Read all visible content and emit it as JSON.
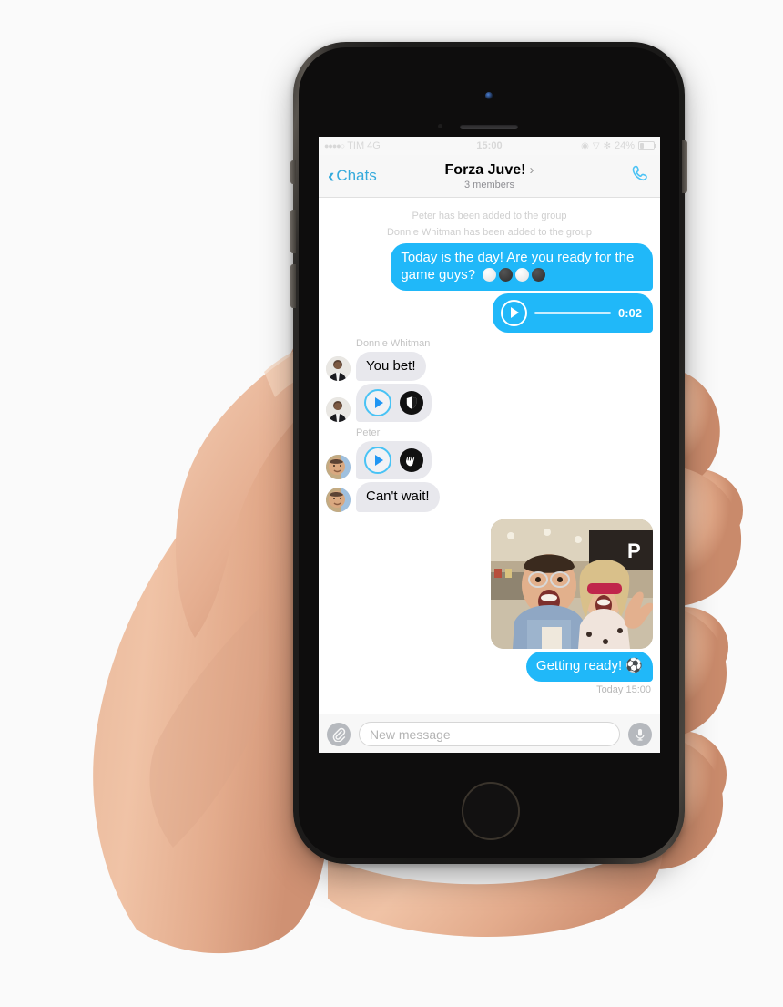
{
  "device": {
    "type": "smartphone",
    "held_in": "hand",
    "home_button": "home-button",
    "camera": "front-camera",
    "speaker": "earpiece-speaker"
  },
  "status_bar": {
    "signal_dots": "●●●●○",
    "carrier": "TIM",
    "network": "4G",
    "time": "15:00",
    "battery_percent": "24%",
    "battery_level": 24,
    "icons": [
      "location-icon",
      "wifi-icon",
      "bluetooth-icon",
      "battery-icon"
    ]
  },
  "nav_bar": {
    "back_label": "Chats",
    "title": "Forza Juve!",
    "subtitle": "3 members",
    "disclosure": "›",
    "call_icon": "phone-call-icon"
  },
  "conversation": {
    "system_messages": [
      "Peter has been added to the group",
      "Donnie Whitman has been added to the group"
    ],
    "messages": [
      {
        "id": "m1",
        "direction": "out",
        "type": "text",
        "text": "Today is the day! Are you ready for the game guys?",
        "emoji_balls": [
          "white",
          "black",
          "white",
          "black"
        ]
      },
      {
        "id": "m2",
        "direction": "out",
        "type": "audio",
        "duration": "0:02",
        "play_icon": "play-icon"
      },
      {
        "id": "m3",
        "direction": "in",
        "type": "text",
        "sender": "Donnie Whitman",
        "show_sender": true,
        "text": "You bet!",
        "avatar": "donnie-whitman-avatar"
      },
      {
        "id": "m4",
        "direction": "in",
        "type": "audio",
        "sender": "Donnie Whitman",
        "show_sender": false,
        "avatar": "donnie-whitman-avatar",
        "play_icon": "play-icon",
        "sticker": "shield-badge-sticker",
        "sticker_glyph": "🛡"
      },
      {
        "id": "m5",
        "direction": "in",
        "type": "audio",
        "sender": "Peter",
        "show_sender": true,
        "avatar": "peter-avatar",
        "play_icon": "play-icon",
        "sticker": "clapping-hand-sticker",
        "sticker_glyph": "👏"
      },
      {
        "id": "m6",
        "direction": "in",
        "type": "text",
        "sender": "Peter",
        "show_sender": false,
        "text": "Can't wait!",
        "avatar": "peter-avatar"
      },
      {
        "id": "m7",
        "direction": "out",
        "type": "photo",
        "caption": "selfie of two people smiling in a shopping mall"
      },
      {
        "id": "m8",
        "direction": "out",
        "type": "text",
        "text": "Getting ready! ⚽"
      }
    ],
    "timestamp": "Today 15:00"
  },
  "input_bar": {
    "attach_icon": "paperclip-icon",
    "placeholder": "New message",
    "value": "",
    "mic_icon": "microphone-icon"
  },
  "colors": {
    "accent_blue": "#34aadc",
    "bubble_out": "#20b8f9",
    "bubble_in": "#e8e8ed",
    "system_text": "#cfcfcf",
    "sender_name": "#c4c4c4",
    "nav_bg": "#f7f7f7"
  }
}
